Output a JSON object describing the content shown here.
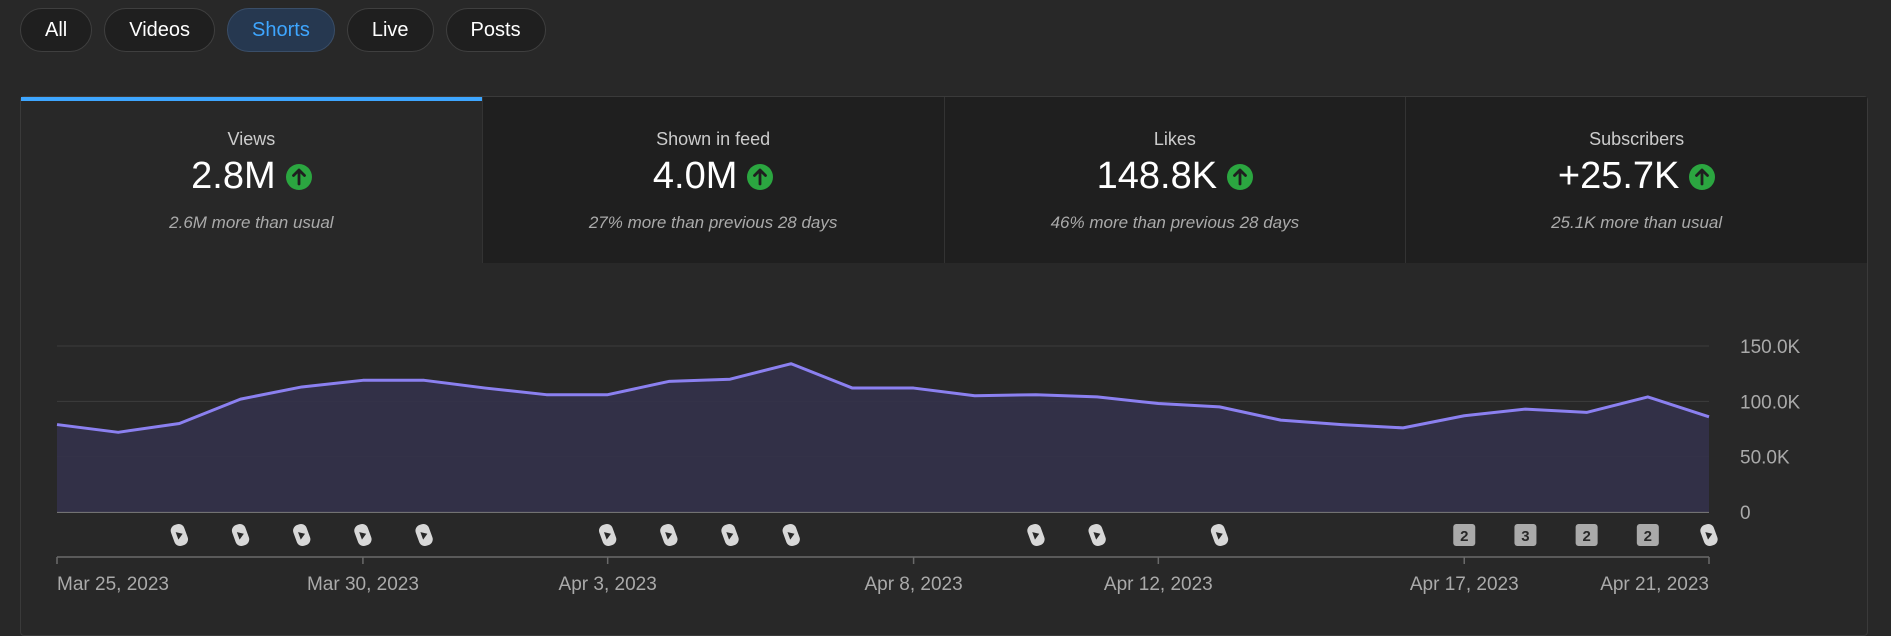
{
  "tabs": [
    {
      "label": "All",
      "active": false
    },
    {
      "label": "Videos",
      "active": false
    },
    {
      "label": "Shorts",
      "active": true
    },
    {
      "label": "Live",
      "active": false
    },
    {
      "label": "Posts",
      "active": false
    }
  ],
  "metrics": [
    {
      "label": "Views",
      "value": "2.8M",
      "trend_icon": "arrow-up-icon",
      "note": "2.6M more than usual",
      "selected": true
    },
    {
      "label": "Shown in feed",
      "value": "4.0M",
      "trend_icon": "arrow-up-icon",
      "note": "27% more than previous 28 days",
      "selected": false
    },
    {
      "label": "Likes",
      "value": "148.8K",
      "trend_icon": "arrow-up-icon",
      "note": "46% more than previous 28 days",
      "selected": false
    },
    {
      "label": "Subscribers",
      "value": "+25.7K",
      "trend_icon": "arrow-up-icon",
      "note": "25.1K more than usual",
      "selected": false
    }
  ],
  "colors": {
    "accent": "#3ea6ff",
    "line": "#8b80f0",
    "area": "#33314a",
    "trend_up": "#2ba640"
  },
  "chart_data": {
    "type": "area",
    "y_ticks": [
      "150.0K",
      "100.0K",
      "50.0K",
      "0"
    ],
    "y_tick_values": [
      150000,
      100000,
      50000,
      0
    ],
    "ylim": [
      0,
      150000
    ],
    "x_tick_labels": [
      {
        "label": "Mar 25, 2023",
        "index": 0
      },
      {
        "label": "Mar 30, 2023",
        "index": 5
      },
      {
        "label": "Apr 3, 2023",
        "index": 9
      },
      {
        "label": "Apr 8, 2023",
        "index": 14
      },
      {
        "label": "Apr 12, 2023",
        "index": 18
      },
      {
        "label": "Apr 17, 2023",
        "index": 23
      },
      {
        "label": "Apr 21, 2023",
        "index": 27
      }
    ],
    "x": [
      "Mar 25",
      "Mar 26",
      "Mar 27",
      "Mar 28",
      "Mar 29",
      "Mar 30",
      "Mar 31",
      "Apr 1",
      "Apr 2",
      "Apr 3",
      "Apr 4",
      "Apr 5",
      "Apr 6",
      "Apr 7",
      "Apr 8",
      "Apr 9",
      "Apr 10",
      "Apr 11",
      "Apr 12",
      "Apr 13",
      "Apr 14",
      "Apr 15",
      "Apr 16",
      "Apr 17",
      "Apr 18",
      "Apr 19",
      "Apr 20",
      "Apr 21"
    ],
    "series": [
      {
        "values": [
          79000,
          72000,
          80000,
          102000,
          113000,
          119000,
          119000,
          112000,
          106000,
          106000,
          118000,
          120000,
          134000,
          112000,
          112000,
          105000,
          106000,
          104000,
          98000,
          95000,
          83000,
          79000,
          76000,
          87000,
          93000,
          90000,
          104000,
          86000
        ]
      }
    ],
    "publish_markers": [
      {
        "index": 2,
        "kind": "shorts-icon"
      },
      {
        "index": 3,
        "kind": "shorts-icon"
      },
      {
        "index": 4,
        "kind": "shorts-icon"
      },
      {
        "index": 5,
        "kind": "shorts-icon"
      },
      {
        "index": 6,
        "kind": "shorts-icon"
      },
      {
        "index": 9,
        "kind": "shorts-icon"
      },
      {
        "index": 10,
        "kind": "shorts-icon"
      },
      {
        "index": 11,
        "kind": "shorts-icon"
      },
      {
        "index": 12,
        "kind": "shorts-icon"
      },
      {
        "index": 16,
        "kind": "shorts-icon"
      },
      {
        "index": 17,
        "kind": "shorts-icon"
      },
      {
        "index": 19,
        "kind": "shorts-icon"
      },
      {
        "index": 23,
        "kind": "count",
        "count": "2"
      },
      {
        "index": 24,
        "kind": "count",
        "count": "3"
      },
      {
        "index": 25,
        "kind": "count",
        "count": "2"
      },
      {
        "index": 26,
        "kind": "count",
        "count": "2"
      },
      {
        "index": 27,
        "kind": "shorts-icon"
      }
    ],
    "grid": true
  }
}
